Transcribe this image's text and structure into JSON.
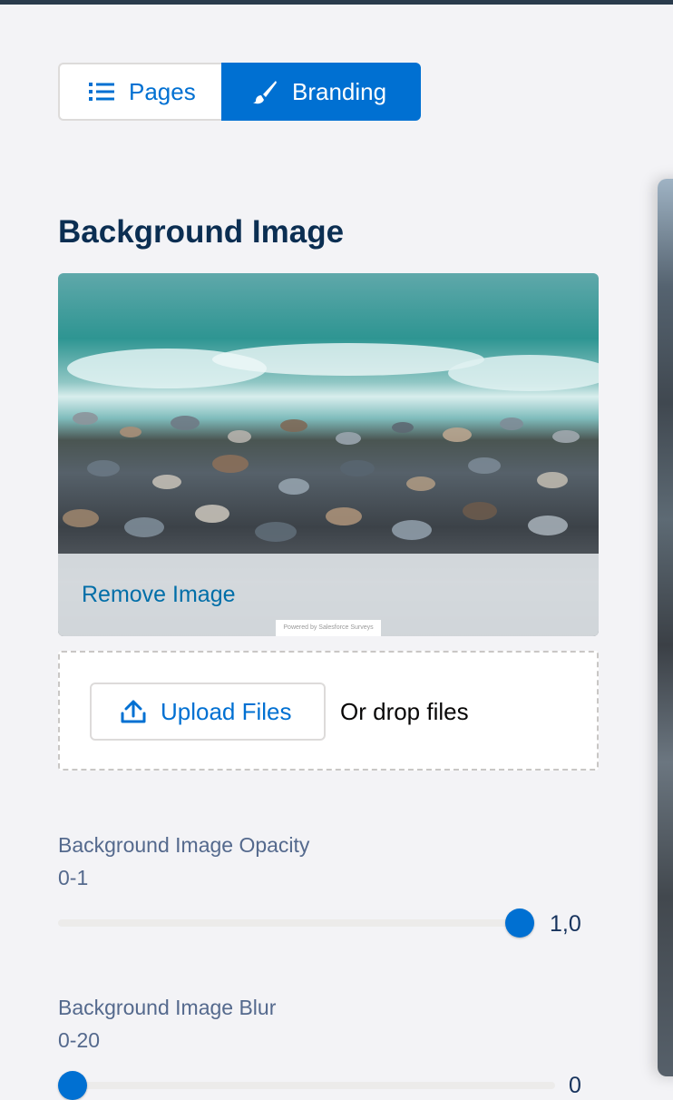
{
  "tabs": {
    "pages_label": "Pages",
    "branding_label": "Branding",
    "active": "Branding"
  },
  "background_image": {
    "title": "Background Image",
    "remove_label": "Remove Image",
    "watermark": "Powered by Salesforce Surveys",
    "upload_label": "Upload Files",
    "drop_label": "Or drop files"
  },
  "opacity": {
    "label": "Background Image Opacity",
    "range": "0-1",
    "value": "1,0",
    "fraction": 1.0
  },
  "blur": {
    "label": "Background Image Blur",
    "range": "0-20",
    "value": "0",
    "fraction": 0.0
  },
  "colors": {
    "accent": "#0070d2",
    "heading": "#0b2e52",
    "label": "#54698d",
    "background": "#f3f3f6"
  }
}
